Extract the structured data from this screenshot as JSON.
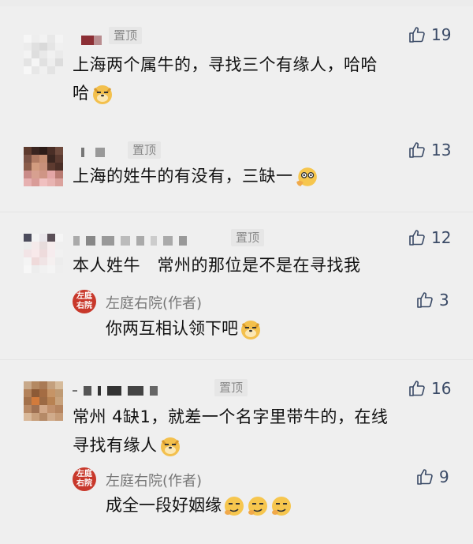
{
  "pin_label": "置顶",
  "comments": [
    {
      "likes": "19",
      "text_line1": "上海两个属牛的，寻找三个有缘人，哈哈",
      "text_line2": "哈",
      "emoji": "doge-emoji"
    },
    {
      "likes": "13",
      "text_line1": "上海的姓牛的有没有，三缺一",
      "emoji": "thinking-emoji"
    },
    {
      "likes": "12",
      "text_line1": "本人姓牛   常州的那位是不是在寻找我",
      "reply": {
        "badge": "左庭右院",
        "author": "左庭右院(作者)",
        "likes": "3",
        "text": "你两互相认领下吧",
        "emoji": "doge-emoji"
      }
    },
    {
      "likes": "16",
      "text_line1": "常州 4缺1，就差一个名字里带牛的，在线",
      "text_line2": "寻找有缘人",
      "emoji": "doge-emoji",
      "reply": {
        "badge": "左庭右院",
        "author": "左庭右院(作者)",
        "likes": "9",
        "text": "成全一段好姻缘",
        "emoji": "sly-emoji"
      }
    }
  ],
  "colors": {
    "background": "#efefef",
    "like_color": "#3a4a66",
    "author_badge": "#c8382b"
  }
}
